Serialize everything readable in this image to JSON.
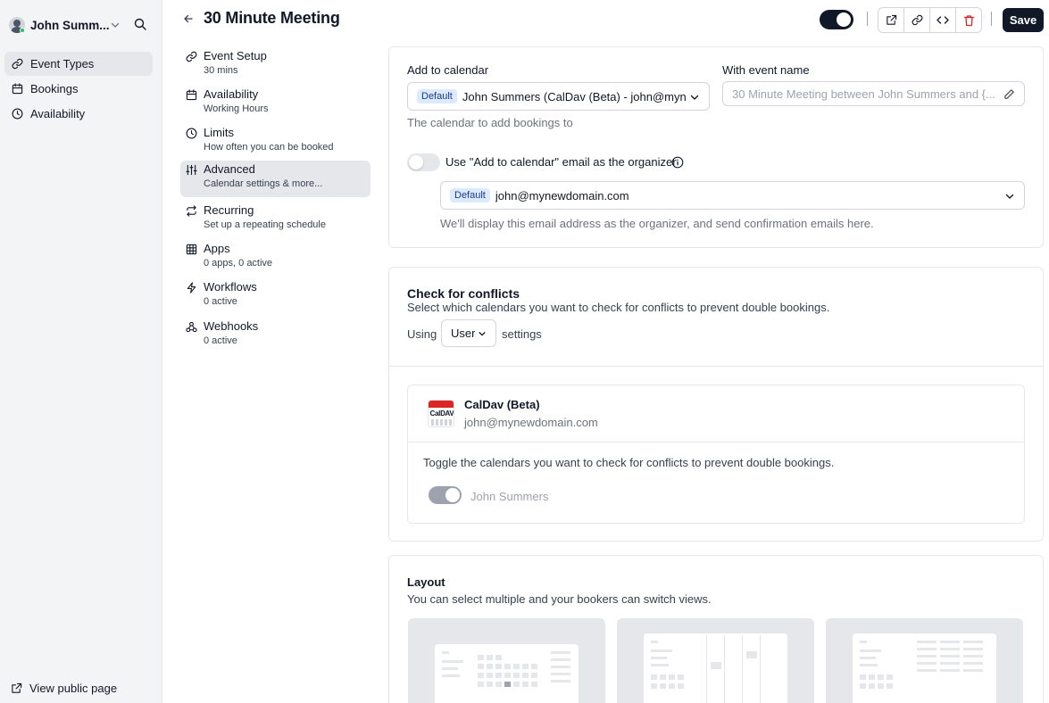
{
  "sidebar": {
    "user_name": "John Summ...",
    "items": [
      {
        "label": "Event Types"
      },
      {
        "label": "Bookings"
      },
      {
        "label": "Availability"
      }
    ],
    "view_public_page": "View public page"
  },
  "header": {
    "title": "30 Minute Meeting",
    "save_label": "Save"
  },
  "subnav": [
    {
      "title": "Event Setup",
      "desc": "30 mins"
    },
    {
      "title": "Availability",
      "desc": "Working Hours"
    },
    {
      "title": "Limits",
      "desc": "How often you can be booked"
    },
    {
      "title": "Advanced",
      "desc": "Calendar settings & more..."
    },
    {
      "title": "Recurring",
      "desc": "Set up a repeating schedule"
    },
    {
      "title": "Apps",
      "desc": "0 apps, 0 active"
    },
    {
      "title": "Workflows",
      "desc": "0 active"
    },
    {
      "title": "Webhooks",
      "desc": "0 active"
    }
  ],
  "calendar_card": {
    "add_to_calendar_label": "Add to calendar",
    "default_badge": "Default",
    "calendar_value": "John Summers (CalDav (Beta) - john@mynewdomain.com)",
    "calendar_hint": "The calendar to add bookings to",
    "event_name_label": "With event name",
    "event_name_placeholder": "30 Minute Meeting between John Summers and {...",
    "organizer_toggle_label": "Use \"Add to calendar\" email as the organizer",
    "organizer_email": "john@mynewdomain.com",
    "organizer_hint": "We'll display this email address as the organizer, and send confirmation emails here."
  },
  "conflicts_card": {
    "title": "Check for conflicts",
    "subtitle": "Select which calendars you want to check for conflicts to prevent double bookings.",
    "using_prefix": "Using",
    "using_value": "User",
    "using_suffix": "settings",
    "integration_name": "CalDav (Beta)",
    "integration_email": "john@mynewdomain.com",
    "integration_logo_text": "CalDAV",
    "toggle_hint": "Toggle the calendars you want to check for conflicts to prevent double bookings.",
    "calendar_name": "John Summers"
  },
  "layout_card": {
    "title": "Layout",
    "subtitle": "You can select multiple and your bookers can switch views."
  }
}
